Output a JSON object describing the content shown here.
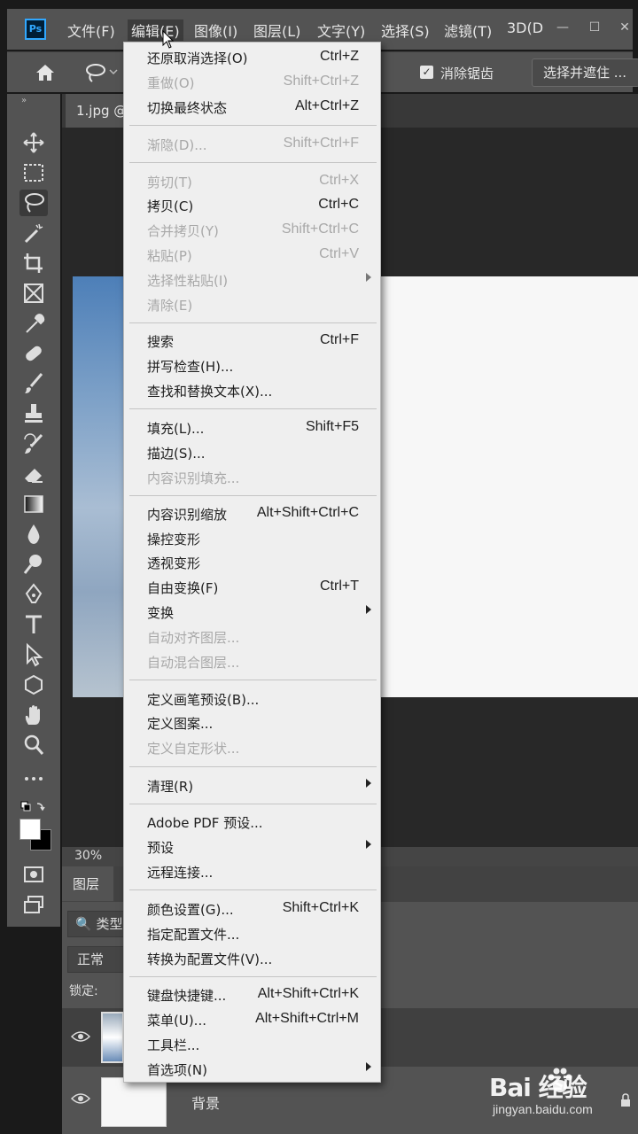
{
  "app": {
    "logo_text": "Ps"
  },
  "menubar": {
    "items": [
      "文件(F)",
      "编辑(E)",
      "图像(I)",
      "图层(L)",
      "文字(Y)",
      "选择(S)",
      "滤镜(T)",
      "3D(D"
    ],
    "active_index": 1
  },
  "options_bar": {
    "antialias_label": "消除锯齿",
    "antialias_checked": true,
    "select_mask_label": "选择并遮住 ..."
  },
  "document": {
    "tab_label": "1.jpg @",
    "zoom": "30%"
  },
  "layers_panel": {
    "tab_label": "图层",
    "filter_label": "类型",
    "blend_mode": "正常",
    "lock_label": "锁定:",
    "layers": [
      {
        "name": ""
      },
      {
        "name": "背景"
      }
    ]
  },
  "edit_menu": {
    "items": [
      {
        "label": "还原取消选择(O)",
        "shortcut": "Ctrl+Z",
        "enabled": true,
        "submenu": false
      },
      {
        "label": "重做(O)",
        "shortcut": "Shift+Ctrl+Z",
        "enabled": false,
        "submenu": false
      },
      {
        "label": "切换最终状态",
        "shortcut": "Alt+Ctrl+Z",
        "enabled": true,
        "submenu": false
      },
      {
        "label": "渐隐(D)...",
        "shortcut": "Shift+Ctrl+F",
        "enabled": false,
        "submenu": false
      },
      {
        "label": "剪切(T)",
        "shortcut": "Ctrl+X",
        "enabled": false,
        "submenu": false
      },
      {
        "label": "拷贝(C)",
        "shortcut": "Ctrl+C",
        "enabled": true,
        "submenu": false
      },
      {
        "label": "合并拷贝(Y)",
        "shortcut": "Shift+Ctrl+C",
        "enabled": false,
        "submenu": false
      },
      {
        "label": "粘贴(P)",
        "shortcut": "Ctrl+V",
        "enabled": false,
        "submenu": false
      },
      {
        "label": "选择性粘贴(I)",
        "shortcut": "",
        "enabled": false,
        "submenu": true
      },
      {
        "label": "清除(E)",
        "shortcut": "",
        "enabled": false,
        "submenu": false
      },
      {
        "label": "搜索",
        "shortcut": "Ctrl+F",
        "enabled": true,
        "submenu": false
      },
      {
        "label": "拼写检查(H)...",
        "shortcut": "",
        "enabled": true,
        "submenu": false
      },
      {
        "label": "查找和替换文本(X)...",
        "shortcut": "",
        "enabled": true,
        "submenu": false
      },
      {
        "label": "填充(L)...",
        "shortcut": "Shift+F5",
        "enabled": true,
        "submenu": false
      },
      {
        "label": "描边(S)...",
        "shortcut": "",
        "enabled": true,
        "submenu": false
      },
      {
        "label": "内容识别填充...",
        "shortcut": "",
        "enabled": false,
        "submenu": false
      },
      {
        "label": "内容识别缩放",
        "shortcut": "Alt+Shift+Ctrl+C",
        "enabled": true,
        "submenu": false
      },
      {
        "label": "操控变形",
        "shortcut": "",
        "enabled": true,
        "submenu": false
      },
      {
        "label": "透视变形",
        "shortcut": "",
        "enabled": true,
        "submenu": false
      },
      {
        "label": "自由变换(F)",
        "shortcut": "Ctrl+T",
        "enabled": true,
        "submenu": false
      },
      {
        "label": "变换",
        "shortcut": "",
        "enabled": true,
        "submenu": true
      },
      {
        "label": "自动对齐图层...",
        "shortcut": "",
        "enabled": false,
        "submenu": false
      },
      {
        "label": "自动混合图层...",
        "shortcut": "",
        "enabled": false,
        "submenu": false
      },
      {
        "label": "定义画笔预设(B)...",
        "shortcut": "",
        "enabled": true,
        "submenu": false
      },
      {
        "label": "定义图案...",
        "shortcut": "",
        "enabled": true,
        "submenu": false
      },
      {
        "label": "定义自定形状...",
        "shortcut": "",
        "enabled": false,
        "submenu": false
      },
      {
        "label": "清理(R)",
        "shortcut": "",
        "enabled": true,
        "submenu": true
      },
      {
        "label": "Adobe PDF 预设...",
        "shortcut": "",
        "enabled": true,
        "submenu": false
      },
      {
        "label": "预设",
        "shortcut": "",
        "enabled": true,
        "submenu": true
      },
      {
        "label": "远程连接...",
        "shortcut": "",
        "enabled": true,
        "submenu": false
      },
      {
        "label": "颜色设置(G)...",
        "shortcut": "Shift+Ctrl+K",
        "enabled": true,
        "submenu": false
      },
      {
        "label": "指定配置文件...",
        "shortcut": "",
        "enabled": true,
        "submenu": false
      },
      {
        "label": "转换为配置文件(V)...",
        "shortcut": "",
        "enabled": true,
        "submenu": false
      },
      {
        "label": "键盘快捷键...",
        "shortcut": "Alt+Shift+Ctrl+K",
        "enabled": true,
        "submenu": false
      },
      {
        "label": "菜单(U)...",
        "shortcut": "Alt+Shift+Ctrl+M",
        "enabled": true,
        "submenu": false
      },
      {
        "label": "工具栏...",
        "shortcut": "",
        "enabled": true,
        "submenu": false
      },
      {
        "label": "首选项(N)",
        "shortcut": "",
        "enabled": true,
        "submenu": true
      }
    ]
  },
  "tools": [
    "move-icon",
    "marquee-icon",
    "lasso-icon",
    "magic-wand-icon",
    "crop-icon",
    "frame-icon",
    "eyedropper-icon",
    "healing-icon",
    "brush-icon",
    "stamp-icon",
    "history-brush-icon",
    "eraser-icon",
    "gradient-icon",
    "blur-icon",
    "dodge-icon",
    "pen-icon",
    "type-icon",
    "path-select-icon",
    "shape-icon",
    "hand-icon",
    "zoom-icon",
    "more-tools-icon"
  ],
  "watermark": {
    "brand": "Bai 经验",
    "url": "jingyan.baidu.com"
  },
  "colors": {
    "menu_bg": "#efefef",
    "chrome": "#535353",
    "canvas": "#282828",
    "accent": "#31a8ff"
  }
}
